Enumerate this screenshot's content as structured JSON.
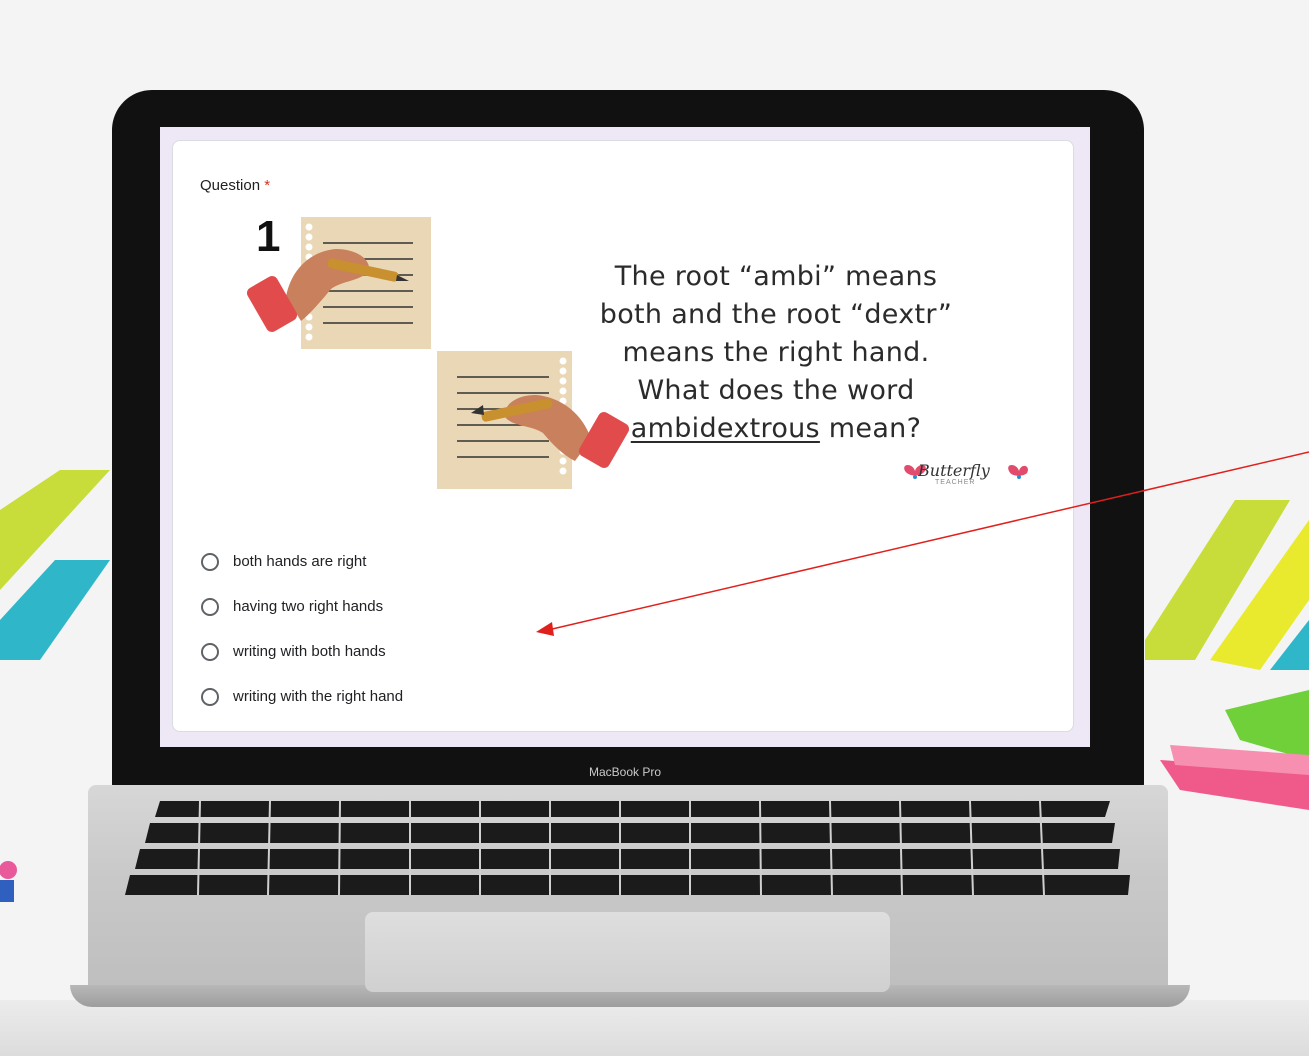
{
  "form": {
    "question_label": "Question",
    "required_mark": "*",
    "question_number": "1",
    "prompt_line1": "The root “ambi” means",
    "prompt_line2": "both and the root “dextr”",
    "prompt_line3": "means the right hand.",
    "prompt_line4_pre": "What does the word",
    "prompt_keyword": "ambidextrous",
    "prompt_line5_post": " mean?",
    "brand_name": "Butterfly",
    "brand_sub": "TEACHER",
    "options": [
      {
        "label": "both hands are right"
      },
      {
        "label": "having two right hands"
      },
      {
        "label": "writing with both hands"
      },
      {
        "label": "writing with the right hand"
      }
    ]
  },
  "device": {
    "model_label": "MacBook Pro"
  },
  "colors": {
    "form_background": "#ede7f6",
    "required": "#d93025",
    "annotation_arrow": "#e0201c"
  }
}
